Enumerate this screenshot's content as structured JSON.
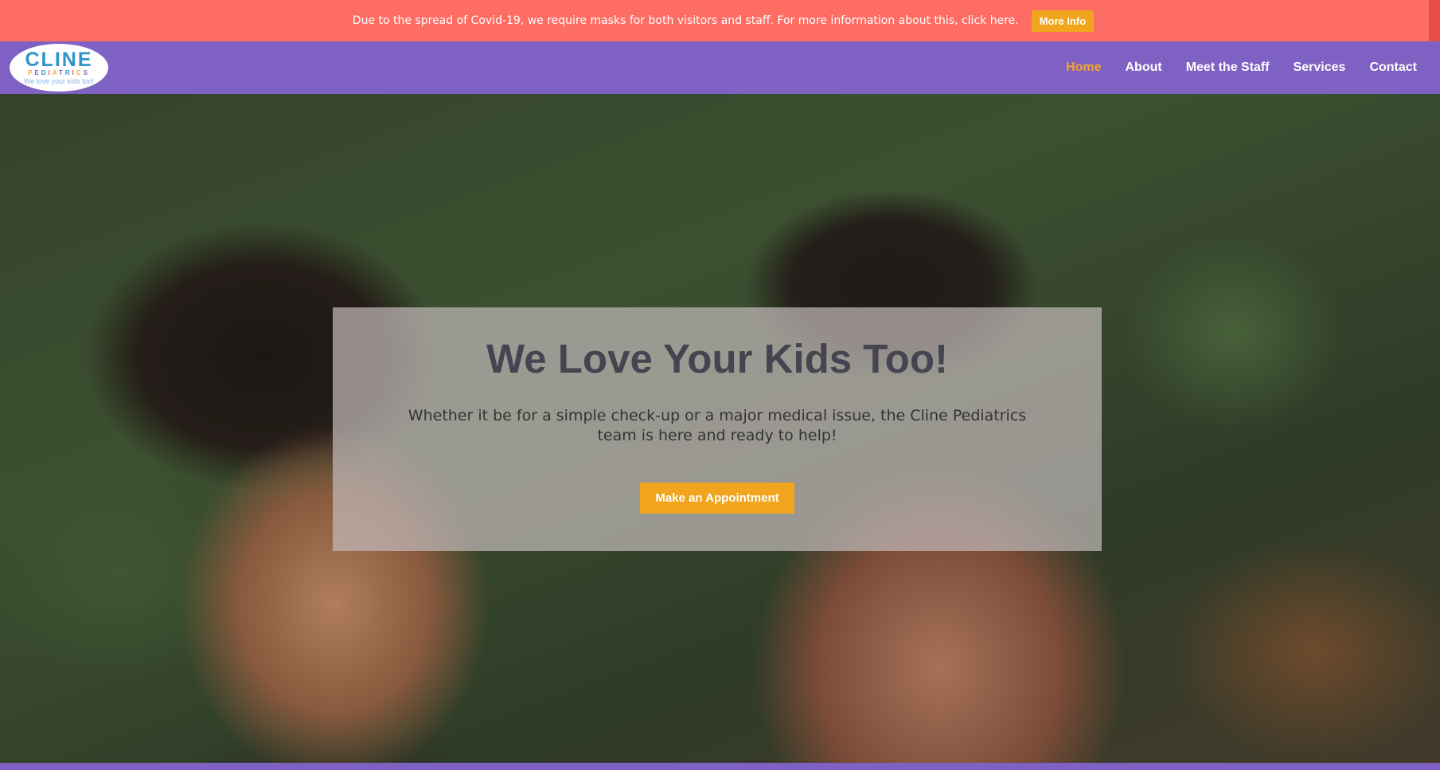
{
  "notice": {
    "text": "Due to the spread of Covid-19, we require masks for both visitors and staff. For more information about this, click here.",
    "button_label": "More Info"
  },
  "logo": {
    "name_letters": [
      "C",
      "L",
      "I",
      "N",
      "E"
    ],
    "name_colors": [
      "#2f94c8",
      "#2f94c8",
      "#2f94c8",
      "#2f94c8",
      "#2f94c8"
    ],
    "sub_letters": [
      "P",
      "E",
      "D",
      "I",
      "A",
      "T",
      "R",
      "I",
      "C",
      "S"
    ],
    "sub_colors": [
      "#f3a62b",
      "#7f61c3",
      "#2f94c8",
      "#e6544f",
      "#f3a62b",
      "#7f61c3",
      "#2f94c8",
      "#e6544f",
      "#f3a62b",
      "#7f61c3"
    ],
    "tagline": "We love your kids too!"
  },
  "nav": {
    "items": [
      {
        "label": "Home",
        "active": true
      },
      {
        "label": "About",
        "active": false
      },
      {
        "label": "Meet the Staff",
        "active": false
      },
      {
        "label": "Services",
        "active": false
      },
      {
        "label": "Contact",
        "active": false
      }
    ]
  },
  "hero": {
    "title": "We Love Your Kids Too!",
    "text": "Whether it be for a simple check-up or a major medical issue, the Cline Pediatrics team is here and ready to help!",
    "button_label": "Make an Appointment"
  },
  "colors": {
    "notice_bg": "#fd6d64",
    "header_bg": "#7f61c3",
    "accent": "#f0a51c",
    "nav_active": "#f3a62b"
  }
}
